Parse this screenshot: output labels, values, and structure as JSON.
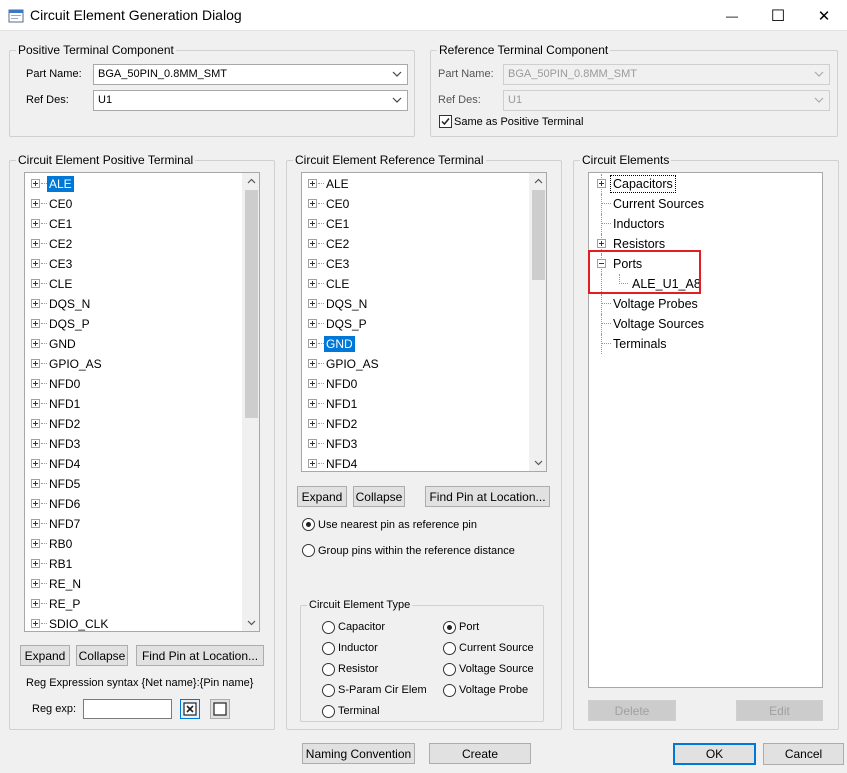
{
  "window": {
    "title": "Circuit Element Generation Dialog",
    "minimize_glyph": "—",
    "maximize_glyph": "☐",
    "close_glyph": "✕"
  },
  "positive_component": {
    "legend": "Positive Terminal Component",
    "part_name_label": "Part Name:",
    "part_name_value": "BGA_50PIN_0.8MM_SMT",
    "ref_des_label": "Ref Des:",
    "ref_des_value": "U1"
  },
  "reference_component": {
    "legend": "Reference Terminal Component",
    "part_name_label": "Part Name:",
    "part_name_value": "BGA_50PIN_0.8MM_SMT",
    "ref_des_label": "Ref Des:",
    "ref_des_value": "U1",
    "same_as_positive_label": "Same as Positive Terminal",
    "same_as_positive_checked": true
  },
  "positive_terminal": {
    "legend": "Circuit Element Positive Terminal",
    "items": [
      "ALE",
      "CE0",
      "CE1",
      "CE2",
      "CE3",
      "CLE",
      "DQS_N",
      "DQS_P",
      "GND",
      "GPIO_AS",
      "NFD0",
      "NFD1",
      "NFD2",
      "NFD3",
      "NFD4",
      "NFD5",
      "NFD6",
      "NFD7",
      "RB0",
      "RB1",
      "RE_N",
      "RE_P",
      "SDIO_CLK"
    ],
    "selected": "ALE",
    "expand_label": "Expand",
    "collapse_label": "Collapse",
    "find_pin_label": "Find Pin at Location...",
    "regex_hint": "Reg Expression syntax {Net name}:{Pin name}",
    "regex_label": "Reg exp:",
    "regex_value": ""
  },
  "reference_terminal": {
    "legend": "Circuit Element Reference Terminal",
    "items": [
      "ALE",
      "CE0",
      "CE1",
      "CE2",
      "CE3",
      "CLE",
      "DQS_N",
      "DQS_P",
      "GND",
      "GPIO_AS",
      "NFD0",
      "NFD1",
      "NFD2",
      "NFD3",
      "NFD4"
    ],
    "selected": "GND",
    "expand_label": "Expand",
    "collapse_label": "Collapse",
    "find_pin_label": "Find Pin at Location...",
    "option_nearest": "Use nearest pin as reference pin",
    "option_group": "Group pins within the reference distance",
    "selected_option": "nearest"
  },
  "element_type": {
    "legend": "Circuit Element Type",
    "options": [
      "Capacitor",
      "Inductor",
      "Resistor",
      "S-Param Cir Elem",
      "Terminal",
      "Port",
      "Current Source",
      "Voltage Source",
      "Voltage Probe"
    ],
    "selected": "Port"
  },
  "circuit_elements": {
    "legend": "Circuit Elements",
    "items": [
      {
        "label": "Capacitors",
        "expander": "plus",
        "focused": true
      },
      {
        "label": "Current Sources",
        "expander": "none"
      },
      {
        "label": "Inductors",
        "expander": "none"
      },
      {
        "label": "Resistors",
        "expander": "plus"
      },
      {
        "label": "Ports",
        "expander": "minus"
      },
      {
        "label": "ALE_U1_A8",
        "expander": "child"
      },
      {
        "label": "Voltage Probes",
        "expander": "none"
      },
      {
        "label": "Voltage Sources",
        "expander": "none"
      },
      {
        "label": "Terminals",
        "expander": "none"
      }
    ],
    "highlight_color": "#e02020",
    "delete_label": "Delete",
    "edit_label": "Edit"
  },
  "footer": {
    "naming_label": "Naming Convention",
    "create_label": "Create",
    "ok_label": "OK",
    "cancel_label": "Cancel"
  },
  "colors": {
    "selection": "#0078d7",
    "dialog_bg": "#f0f0f0"
  }
}
